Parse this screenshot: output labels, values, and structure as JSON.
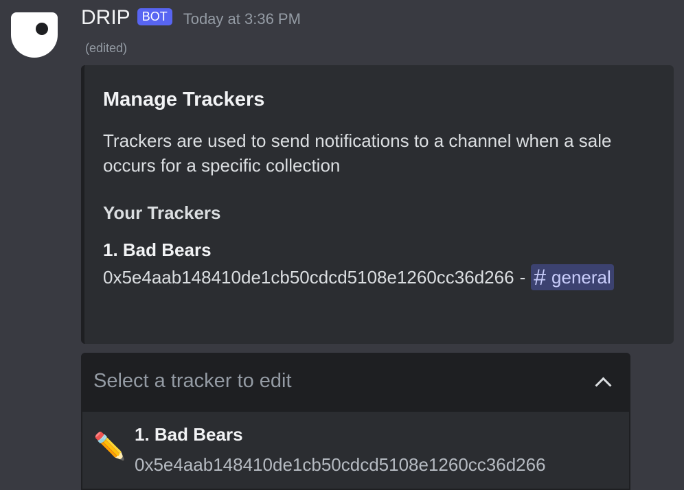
{
  "message": {
    "username": "DRIP",
    "bot_tag": "BOT",
    "timestamp": "Today at 3:36 PM",
    "edited_label": "(edited)"
  },
  "embed": {
    "title": "Manage Trackers",
    "description": "Trackers are used to send notifications to a channel when a sale occurs for a specific collection",
    "field_name": "Your Trackers",
    "trackers": [
      {
        "name": "1. Bad Bears",
        "address": "0x5e4aab148410de1cb50cdcd5108e1260cc36d266",
        "separator": "-",
        "channel_hash": "#",
        "channel": "general"
      }
    ]
  },
  "select_menu": {
    "placeholder": "Select a tracker to edit",
    "options": [
      {
        "emoji": "✏️",
        "label": "1. Bad Bears",
        "description": "0x5e4aab148410de1cb50cdcd5108e1260cc36d266"
      }
    ]
  },
  "colors": {
    "background": "#393a41",
    "embed_background": "#2b2d31",
    "bot_tag": "#5865f2",
    "channel_mention_bg": "#3c4270",
    "select_background": "#1e1f22"
  }
}
